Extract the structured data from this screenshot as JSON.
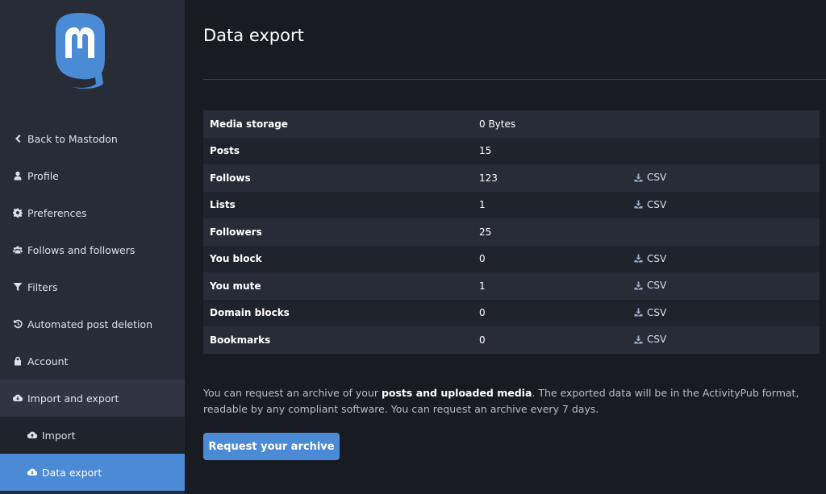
{
  "brand": {
    "accent": "#4b8ad4",
    "logo": "mastodon-logo"
  },
  "sidebar": {
    "items": [
      {
        "label": "Back to Mastodon",
        "icon": "chevron-left-icon"
      },
      {
        "label": "Profile",
        "icon": "user-icon"
      },
      {
        "label": "Preferences",
        "icon": "gear-icon"
      },
      {
        "label": "Follows and followers",
        "icon": "users-icon"
      },
      {
        "label": "Filters",
        "icon": "filter-icon"
      },
      {
        "label": "Automated post deletion",
        "icon": "history-icon"
      },
      {
        "label": "Account",
        "icon": "lock-icon"
      },
      {
        "label": "Import and export",
        "icon": "cloud-download-icon"
      }
    ],
    "subitems": [
      {
        "label": "Import",
        "icon": "cloud-upload-icon"
      },
      {
        "label": "Data export",
        "icon": "cloud-download-icon",
        "active": true
      }
    ]
  },
  "main": {
    "title": "Data export",
    "rows": [
      {
        "label": "Media storage",
        "value": "0 Bytes",
        "action": ""
      },
      {
        "label": "Posts",
        "value": "15",
        "action": ""
      },
      {
        "label": "Follows",
        "value": "123",
        "action": "CSV"
      },
      {
        "label": "Lists",
        "value": "1",
        "action": "CSV"
      },
      {
        "label": "Followers",
        "value": "25",
        "action": ""
      },
      {
        "label": "You block",
        "value": "0",
        "action": "CSV"
      },
      {
        "label": "You mute",
        "value": "1",
        "action": "CSV"
      },
      {
        "label": "Domain blocks",
        "value": "0",
        "action": "CSV"
      },
      {
        "label": "Bookmarks",
        "value": "0",
        "action": "CSV"
      }
    ],
    "hint_before": "You can request an archive of your ",
    "hint_strong": "posts and uploaded media",
    "hint_after": ". The exported data will be in the ActivityPub format, readable by any compliant software. You can request an archive every 7 days.",
    "button_label": "Request your archive"
  }
}
